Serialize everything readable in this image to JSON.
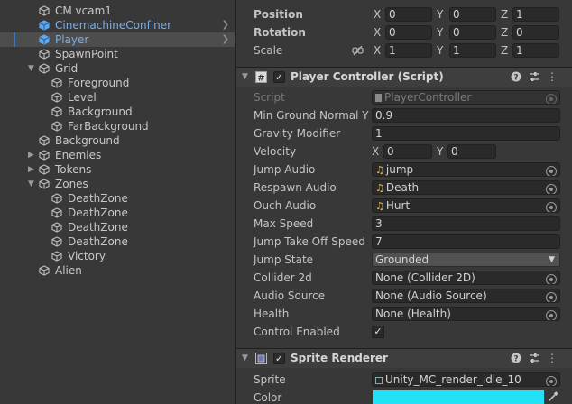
{
  "hierarchy": {
    "items": [
      {
        "label": "CM vcam1",
        "depth": 1,
        "fold": "",
        "prefab": false,
        "selected": false
      },
      {
        "label": "CinemachineConfiner",
        "depth": 1,
        "fold": "",
        "prefab": true,
        "selected": false
      },
      {
        "label": "Player",
        "depth": 1,
        "fold": "",
        "prefab": true,
        "selected": true
      },
      {
        "label": "SpawnPoint",
        "depth": 1,
        "fold": "",
        "prefab": false,
        "selected": false
      },
      {
        "label": "Grid",
        "depth": 1,
        "fold": "expanded",
        "prefab": false,
        "selected": false
      },
      {
        "label": "Foreground",
        "depth": 2,
        "fold": "",
        "prefab": false,
        "selected": false
      },
      {
        "label": "Level",
        "depth": 2,
        "fold": "",
        "prefab": false,
        "selected": false
      },
      {
        "label": "Background",
        "depth": 2,
        "fold": "",
        "prefab": false,
        "selected": false
      },
      {
        "label": "FarBackground",
        "depth": 2,
        "fold": "",
        "prefab": false,
        "selected": false
      },
      {
        "label": "Background",
        "depth": 1,
        "fold": "",
        "prefab": false,
        "selected": false
      },
      {
        "label": "Enemies",
        "depth": 1,
        "fold": "collapsed",
        "prefab": false,
        "selected": false
      },
      {
        "label": "Tokens",
        "depth": 1,
        "fold": "collapsed",
        "prefab": false,
        "selected": false
      },
      {
        "label": "Zones",
        "depth": 1,
        "fold": "expanded",
        "prefab": false,
        "selected": false
      },
      {
        "label": "DeathZone",
        "depth": 2,
        "fold": "",
        "prefab": false,
        "selected": false
      },
      {
        "label": "DeathZone",
        "depth": 2,
        "fold": "",
        "prefab": false,
        "selected": false
      },
      {
        "label": "DeathZone",
        "depth": 2,
        "fold": "",
        "prefab": false,
        "selected": false
      },
      {
        "label": "DeathZone",
        "depth": 2,
        "fold": "",
        "prefab": false,
        "selected": false
      },
      {
        "label": "Victory",
        "depth": 2,
        "fold": "",
        "prefab": false,
        "selected": false
      },
      {
        "label": "Alien",
        "depth": 1,
        "fold": "",
        "prefab": false,
        "selected": false
      }
    ]
  },
  "transform": {
    "position": {
      "label": "Position",
      "x": "0",
      "y": "0",
      "z": "1"
    },
    "rotation": {
      "label": "Rotation",
      "x": "0",
      "y": "0",
      "z": "0"
    },
    "scale": {
      "label": "Scale",
      "x": "1",
      "y": "1",
      "z": "1"
    }
  },
  "axes": {
    "x": "X",
    "y": "Y",
    "z": "Z"
  },
  "player_controller": {
    "title": "Player Controller (Script)",
    "script": {
      "label": "Script",
      "value": "PlayerController"
    },
    "min_ground_normal_y": {
      "label": "Min Ground Normal Y",
      "value": "0.9"
    },
    "gravity_modifier": {
      "label": "Gravity Modifier",
      "value": "1"
    },
    "velocity": {
      "label": "Velocity",
      "x": "0",
      "y": "0"
    },
    "jump_audio": {
      "label": "Jump Audio",
      "value": "jump"
    },
    "respawn_audio": {
      "label": "Respawn Audio",
      "value": "Death"
    },
    "ouch_audio": {
      "label": "Ouch Audio",
      "value": "Hurt"
    },
    "max_speed": {
      "label": "Max Speed",
      "value": "3"
    },
    "jump_take_off_speed": {
      "label": "Jump Take Off Speed",
      "value": "7"
    },
    "jump_state": {
      "label": "Jump State",
      "value": "Grounded"
    },
    "collider_2d": {
      "label": "Collider 2d",
      "value": "None (Collider 2D)"
    },
    "audio_source": {
      "label": "Audio Source",
      "value": "None (Audio Source)"
    },
    "health": {
      "label": "Health",
      "value": "None (Health)"
    },
    "control_enabled": {
      "label": "Control Enabled",
      "checked": true
    }
  },
  "sprite_renderer": {
    "title": "Sprite Renderer",
    "sprite": {
      "label": "Sprite",
      "value": "Unity_MC_render_idle_10"
    },
    "color": {
      "label": "Color",
      "value": "#22e0f5"
    }
  },
  "icons": {
    "hierarchy_item": "cube-icon",
    "script_component": "hash-icon",
    "sprite_component": "sprite-renderer-icon",
    "help": "help-icon",
    "presets": "sliders-icon",
    "menu": "kebab-icon",
    "scale_link": "link-broken-icon",
    "audio": "music-note-icon",
    "eyedropper": "eyedropper-icon"
  }
}
